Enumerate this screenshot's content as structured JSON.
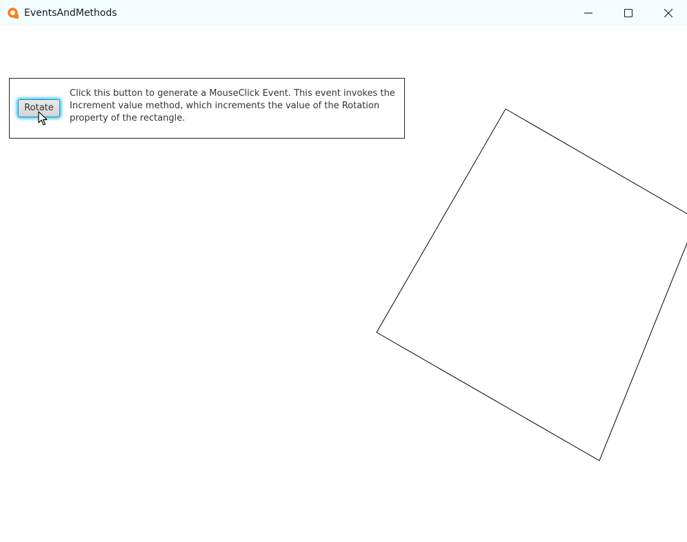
{
  "window": {
    "title": "EventsAndMethods",
    "icon": "app-logo-icon",
    "controls": {
      "minimize_icon": "minimize-icon",
      "maximize_icon": "maximize-icon",
      "close_icon": "close-icon"
    }
  },
  "panel": {
    "button_label": "Rotate",
    "description": "Click this button to generate a MouseClick Event. This event invokes the Increment value method, which increments the value of the Rotation property of the rectangle."
  },
  "colors": {
    "app_icon": "#f58220",
    "button_glow": "#32c4f0",
    "titlebar": "#f3fcfe"
  }
}
